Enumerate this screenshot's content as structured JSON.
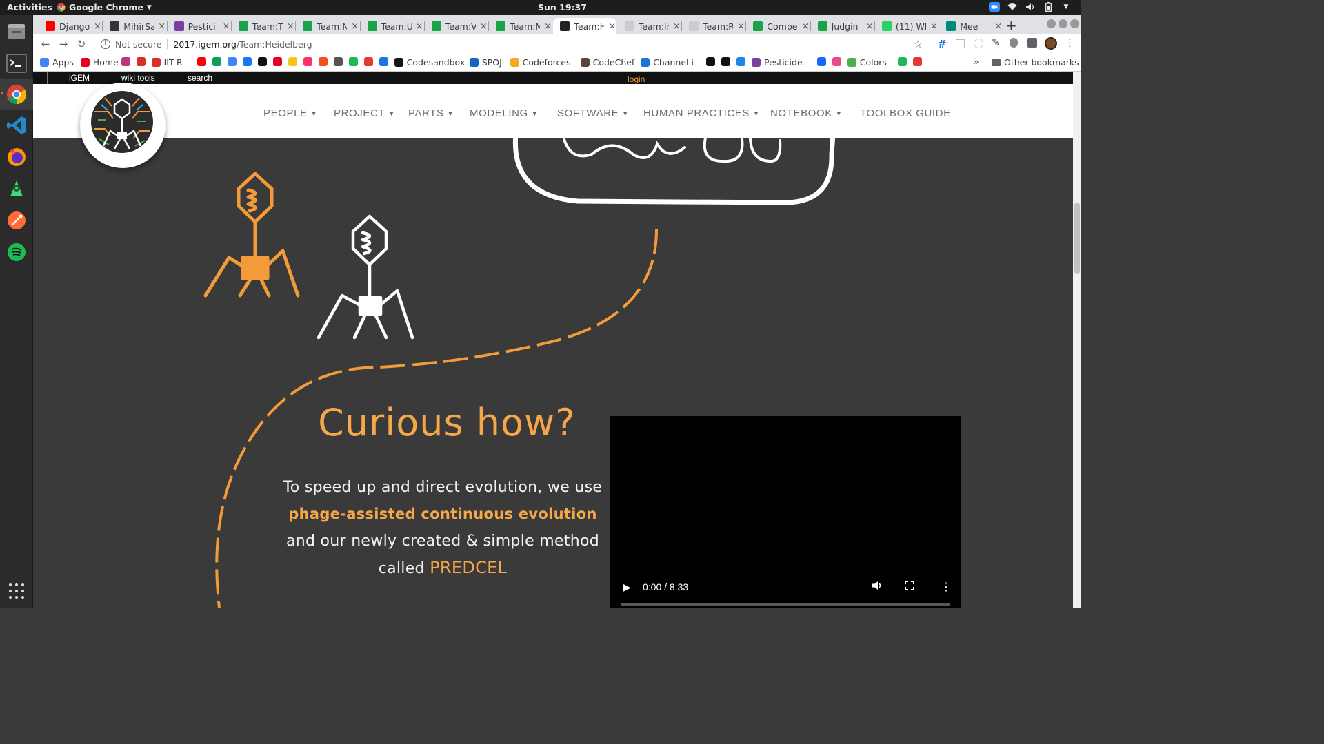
{
  "system": {
    "activities": "Activities",
    "app_name": "Google Chrome",
    "clock": "Sun 19:37"
  },
  "tabs": [
    {
      "title": "Django",
      "color": "#ff0000"
    },
    {
      "title": "MihirSa",
      "color": "#333333"
    },
    {
      "title": "Pestici",
      "color": "#7b3fa0"
    },
    {
      "title": "Team:T",
      "color": "#1aa34a"
    },
    {
      "title": "Team:N",
      "color": "#1aa34a"
    },
    {
      "title": "Team:U",
      "color": "#1aa34a"
    },
    {
      "title": "Team:V",
      "color": "#1aa34a"
    },
    {
      "title": "Team:M",
      "color": "#1aa34a"
    },
    {
      "title": "Team:H",
      "color": "#222222"
    },
    {
      "title": "Team:Ir",
      "color": "#cccccc"
    },
    {
      "title": "Team:R",
      "color": "#cccccc"
    },
    {
      "title": "Compe",
      "color": "#1aa34a"
    },
    {
      "title": "Judgin",
      "color": "#1aa34a"
    },
    {
      "title": "(11) Wh",
      "color": "#25d366"
    },
    {
      "title": "Mee",
      "color": "#00897b"
    }
  ],
  "address": {
    "security": "Not secure",
    "host": "2017.igem.org",
    "path": "/Team:Heidelberg"
  },
  "bookmarks": [
    {
      "label": "Apps",
      "color": "#4285f4"
    },
    {
      "label": "Home",
      "color": "#e60023"
    },
    {
      "label": "",
      "color": "#c13584"
    },
    {
      "label": "",
      "color": "#d93025"
    },
    {
      "label": "IIT-R",
      "color": "#d93025"
    },
    {
      "label": "",
      "color": "#ff0000"
    },
    {
      "label": "",
      "color": "#0f9d58"
    },
    {
      "label": "",
      "color": "#4285f4"
    },
    {
      "label": "",
      "color": "#1877f2"
    },
    {
      "label": "",
      "color": "#111111"
    },
    {
      "label": "",
      "color": "#e60023"
    },
    {
      "label": "",
      "color": "#f5c518"
    },
    {
      "label": "",
      "color": "#ff3366"
    },
    {
      "label": "",
      "color": "#f25022"
    },
    {
      "label": "",
      "color": "#555555"
    },
    {
      "label": "",
      "color": "#1db954"
    },
    {
      "label": "",
      "color": "#e53935"
    },
    {
      "label": "",
      "color": "#1a73e8"
    },
    {
      "label": "Codesandbox",
      "color": "#151515"
    },
    {
      "label": "SPOJ",
      "color": "#1565c0"
    },
    {
      "label": "Codeforces",
      "color": "#f9a825"
    },
    {
      "label": "CodeChef",
      "color": "#5b4638"
    },
    {
      "label": "Channel i",
      "color": "#1976d2"
    },
    {
      "label": "",
      "color": "#111111"
    },
    {
      "label": "",
      "color": "#111111"
    },
    {
      "label": "",
      "color": "#1e88e5"
    },
    {
      "label": "Pesticide",
      "color": "#7b3fa0"
    },
    {
      "label": "",
      "color": "#1769ff"
    },
    {
      "label": "",
      "color": "#ea4c89"
    },
    {
      "label": "Colors",
      "color": "#4caf50"
    },
    {
      "label": "",
      "color": "#1db954"
    },
    {
      "label": "",
      "color": "#e53935"
    }
  ],
  "bookmarks_more": "»",
  "other_bookmarks": "Other bookmarks",
  "igem_bar": {
    "igem": "iGEM",
    "wiki_tools": "wiki tools",
    "search": "search",
    "login": "login"
  },
  "nav": [
    {
      "label": "PEOPLE",
      "caret": true
    },
    {
      "label": "PROJECT",
      "caret": true
    },
    {
      "label": "PARTS",
      "caret": true
    },
    {
      "label": "MODELING",
      "caret": true
    },
    {
      "label": "SOFTWARE",
      "caret": true
    },
    {
      "label": "HUMAN PRACTICES",
      "caret": true
    },
    {
      "label": "NOTEBOOK",
      "caret": true
    },
    {
      "label": "TOOLBOX GUIDE",
      "caret": false
    }
  ],
  "content": {
    "heading": "Curious how?",
    "para_line1": "To speed up and direct evolution, we use",
    "para_highlight": "phage-assisted continuous evolution",
    "para_line3": "and our newly created & simple method",
    "para_called": "called",
    "para_predcel": "PREDCEL"
  },
  "video": {
    "time": "0:00 / 8:33",
    "progress": 0
  },
  "colors": {
    "accent": "#f5a74a",
    "background": "#3a3a3a"
  }
}
